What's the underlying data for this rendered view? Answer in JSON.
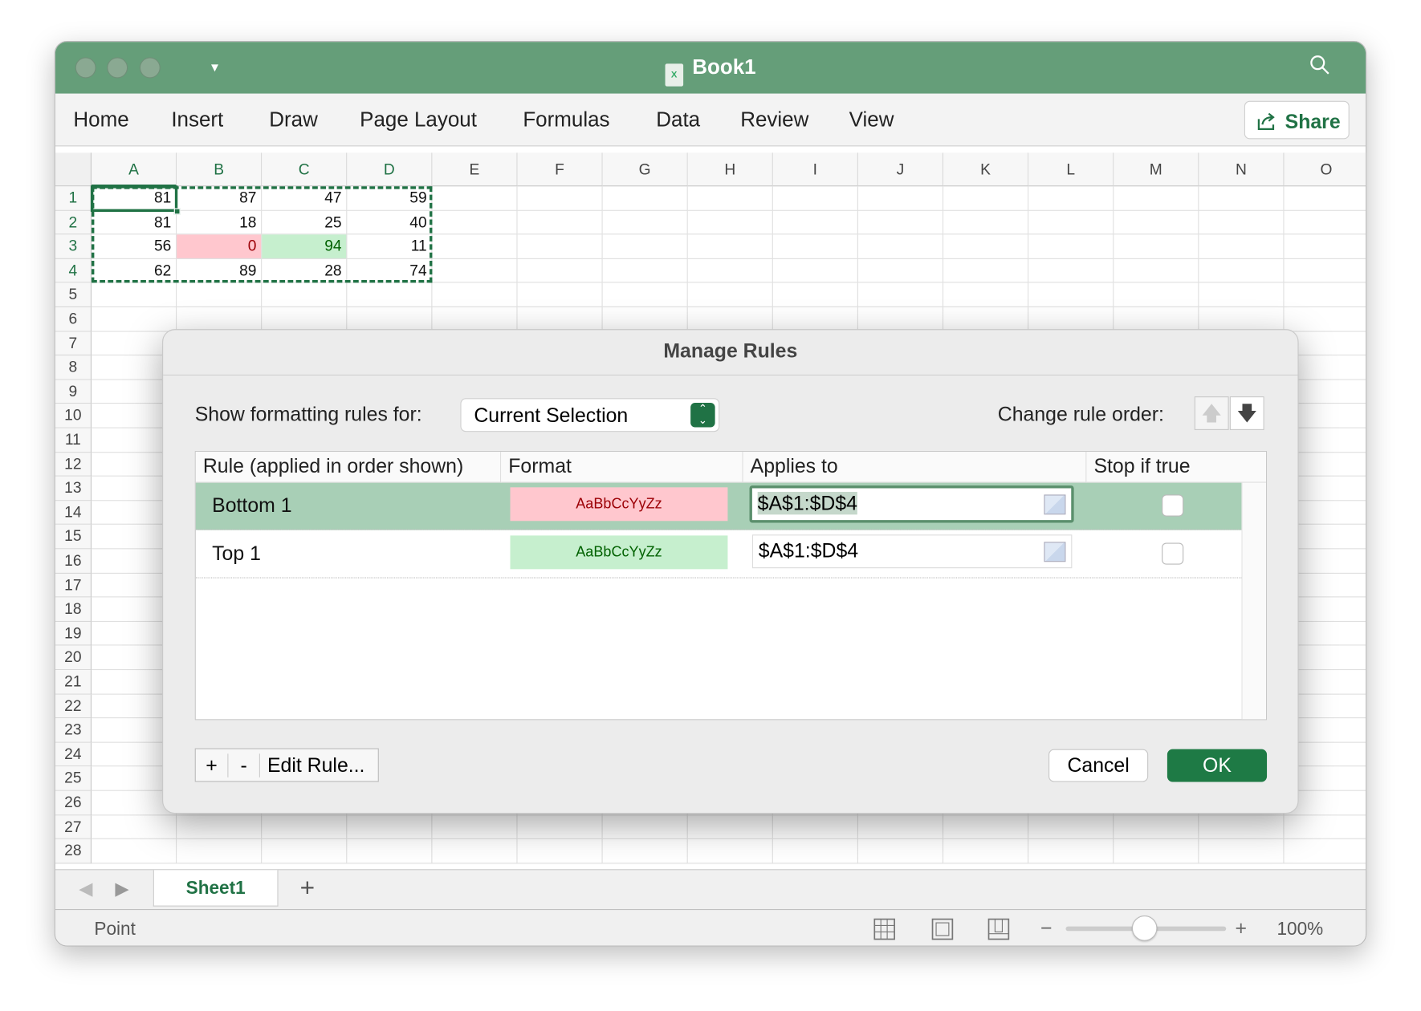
{
  "window": {
    "title": "Book1",
    "title_icon": "excel-document-icon",
    "accent": "#659e79"
  },
  "ribbon": {
    "tabs": [
      "Home",
      "Insert",
      "Draw",
      "Page Layout",
      "Formulas",
      "Data",
      "Review",
      "View"
    ],
    "share_label": "Share"
  },
  "sheet": {
    "columns": [
      "A",
      "B",
      "C",
      "D",
      "E",
      "F",
      "G",
      "H",
      "I",
      "J",
      "K",
      "L",
      "M",
      "N",
      "O"
    ],
    "rows": [
      "1",
      "2",
      "3",
      "4",
      "5",
      "6",
      "7",
      "8",
      "9",
      "10",
      "11",
      "12",
      "13",
      "14",
      "15",
      "16",
      "17",
      "18",
      "19",
      "20",
      "21",
      "22",
      "23",
      "24",
      "25",
      "26",
      "27",
      "28"
    ],
    "values": [
      [
        "81",
        "87",
        "47",
        "59"
      ],
      [
        "81",
        "18",
        "25",
        "40"
      ],
      [
        "56",
        "0",
        "94",
        "11"
      ],
      [
        "62",
        "89",
        "28",
        "74"
      ]
    ],
    "highlight_bottom": {
      "cell": "B3",
      "fill": "#ffc7ce",
      "text": "#9c0006"
    },
    "highlight_top": {
      "cell": "C3",
      "fill": "#c6efce",
      "text": "#006100"
    },
    "active_cell": "A1",
    "selection": "A1:D4"
  },
  "sheet_tabs": {
    "active": "Sheet1",
    "add_label": "+"
  },
  "status": {
    "mode": "Point",
    "zoom": "100%"
  },
  "dialog": {
    "title": "Manage Rules",
    "show_rules_label": "Show formatting rules for:",
    "show_rules_value": "Current Selection",
    "change_order_label": "Change rule order:",
    "headers": [
      "Rule (applied in order shown)",
      "Format",
      "Applies to",
      "Stop if true"
    ],
    "rules": [
      {
        "name": "Bottom 1",
        "preview": "AaBbCcYyZz",
        "fill": "#ffc7ce",
        "color": "#9c0006",
        "applies_to": "$A$1:$D$4",
        "stop_if_true": false,
        "selected": true
      },
      {
        "name": "Top 1",
        "preview": "AaBbCcYyZz",
        "fill": "#c6efce",
        "color": "#006100",
        "applies_to": "$A$1:$D$4",
        "stop_if_true": false,
        "selected": false
      }
    ],
    "add_label": "+",
    "remove_label": "-",
    "edit_label": "Edit Rule...",
    "cancel_label": "Cancel",
    "ok_label": "OK"
  }
}
